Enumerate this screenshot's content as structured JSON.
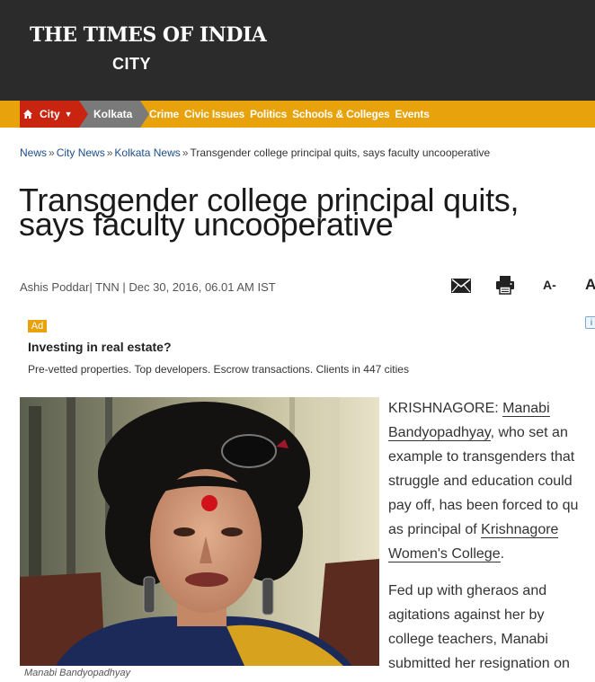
{
  "header": {
    "logo_title": "THE TIMES OF INDIA",
    "logo_subtitle": "CITY"
  },
  "nav": {
    "home_icon": "home-icon",
    "city_label": "City",
    "kolkata_label": "Kolkata",
    "links": [
      "Crime",
      "Civic Issues",
      "Politics",
      "Schools & Colleges",
      "Events"
    ],
    "colors": {
      "bar": "#e8a20b",
      "city": "#c8240f",
      "kolkata": "#7a7a7a"
    }
  },
  "breadcrumb": {
    "items": [
      "News",
      "City News",
      "Kolkata News"
    ],
    "current": "Transgender college principal quits, says faculty uncooperative"
  },
  "article": {
    "headline_line1": "Transgender college principal quits,",
    "headline_line2": "says faculty uncooperative",
    "byline": "Ashis Poddar| TNN | Dec 30, 2016, 06.01 AM IST",
    "tools": {
      "mail_icon": "mail-icon",
      "print_icon": "print-icon",
      "font_decrease": "A-",
      "font_increase": "A"
    },
    "image_caption": "Manabi Bandyopadhyay",
    "paragraph1": {
      "prefix": "KRISHNAGORE: ",
      "link1_line1": "Manabi",
      "link1_line2": "Bandyopadhyay",
      "text_after_link1": ", who set an",
      "line3": "example to transgenders that",
      "line4": "struggle and education could",
      "line5": "pay off, has been forced to qu",
      "line6_prefix": "as principal of ",
      "link2_line1": "Krishnagore",
      "link2_line2": "Women's College",
      "line7_suffix": "."
    },
    "paragraph2": {
      "line1": "Fed up with gheraos and",
      "line2": "agitations against her by",
      "line3": "college teachers, Manabi",
      "line4": "submitted her resignation on"
    }
  },
  "ad": {
    "badge": "Ad",
    "info_icon": "i",
    "title": "Investing in real estate?",
    "description": "Pre-vetted properties. Top developers. Escrow transactions. Clients in 447 cities"
  }
}
